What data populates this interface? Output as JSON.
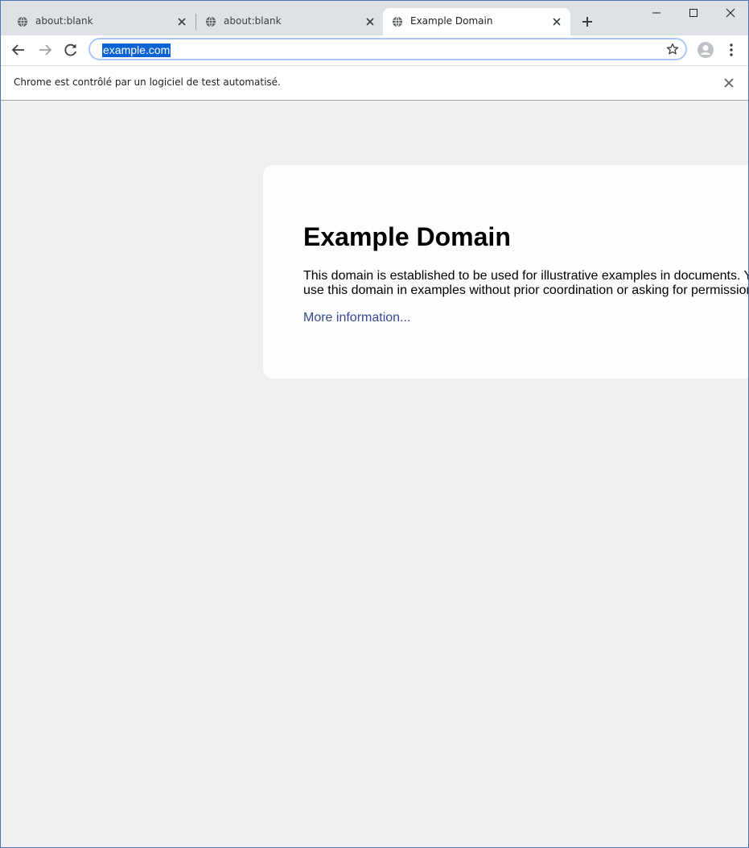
{
  "browser": {
    "tabs": [
      {
        "title": "about:blank",
        "active": false,
        "icon": "globe-icon"
      },
      {
        "title": "about:blank",
        "active": false,
        "icon": "globe-icon"
      },
      {
        "title": "Example Domain",
        "active": true,
        "icon": "globe-icon"
      }
    ],
    "omnibox": {
      "url": "example.com"
    },
    "infobar": {
      "message": "Chrome est contrôlé par un logiciel de test automatisé."
    },
    "colors": {
      "tabstrip_bg": "#dee1e6",
      "selection": "#0a63d3",
      "omnibox_focus_border": "#a8c7fa",
      "window_border": "#4a76b8"
    }
  },
  "page": {
    "heading": "Example Domain",
    "description": "This domain is established to be used for illustrative examples in documents. You may use this domain in examples without prior coordination or asking for permission.",
    "link_text": "More information...",
    "colors": {
      "background": "#f0f0f2",
      "card": "#fdfdff",
      "link": "#38488f"
    }
  }
}
